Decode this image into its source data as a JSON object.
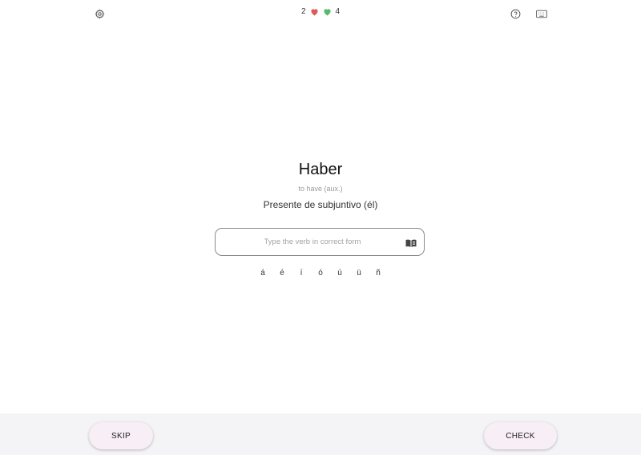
{
  "header": {
    "settings_icon": "gear-icon",
    "help_icon": "help-circle-icon",
    "keyboard_icon": "keyboard-icon",
    "wrong_count": "2",
    "right_count": "4",
    "wrong_color": "#e05a5a",
    "right_color": "#59b86a"
  },
  "exercise": {
    "verb": "Haber",
    "translation": "to have (aux.)",
    "tense": "Presente de subjuntivo (él)",
    "answer_value": "",
    "answer_placeholder": "Type the verb in correct form",
    "conjugation_icon": "book-icon"
  },
  "accents": [
    "á",
    "é",
    "í",
    "ó",
    "ú",
    "ü",
    "ñ"
  ],
  "footer": {
    "skip_label": "SKIP",
    "check_label": "CHECK"
  }
}
